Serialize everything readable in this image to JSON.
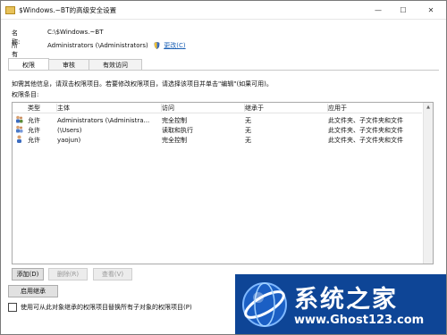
{
  "window": {
    "title": "$Windows.~BT的高级安全设置",
    "minimize": "—",
    "maximize": "☐",
    "close": "✕"
  },
  "info": {
    "name_label": "名称:",
    "name_value": "C:\\$Windows.~BT",
    "owner_label": "所有者:",
    "owner_value": "Administrators (\\Administrators)",
    "change_link": "更改(C)"
  },
  "tabs": [
    {
      "label": "权限"
    },
    {
      "label": "审核"
    },
    {
      "label": "有效访问"
    }
  ],
  "instructions": "如需其他信息，请双击权限项目。若要修改权限项目，请选择该项目并单击\"编辑\"(如果可用)。",
  "entries_label": "权限条目:",
  "table": {
    "headers": [
      "类型",
      "主体",
      "访问",
      "继承于",
      "应用于"
    ],
    "rows": [
      {
        "icon": "admin-group-icon",
        "type": "允许",
        "principal": "Administrators (\\Administra...",
        "access": "完全控制",
        "inherited": "无",
        "applies": "此文件夹、子文件夹和文件"
      },
      {
        "icon": "users-group-icon",
        "type": "允许",
        "principal": "(\\Users)",
        "access": "读取和执行",
        "inherited": "无",
        "applies": "此文件夹、子文件夹和文件"
      },
      {
        "icon": "user-icon",
        "type": "允许",
        "principal": "yaojun)",
        "access": "完全控制",
        "inherited": "无",
        "applies": "此文件夹、子文件夹和文件"
      }
    ]
  },
  "buttons": {
    "add": "添加(D)",
    "remove": "删除(R)",
    "view": "查看(V)",
    "enable_inheritance": "启用继承"
  },
  "checkbox_label": "使用可从此对象继承的权限项目替换所有子对象的权限项目(P)",
  "watermark": {
    "title": "系统之家",
    "url": "www.Ghost123.com"
  },
  "colors": {
    "watermark_bg": "#0e4596",
    "link": "#1a5fb4"
  }
}
